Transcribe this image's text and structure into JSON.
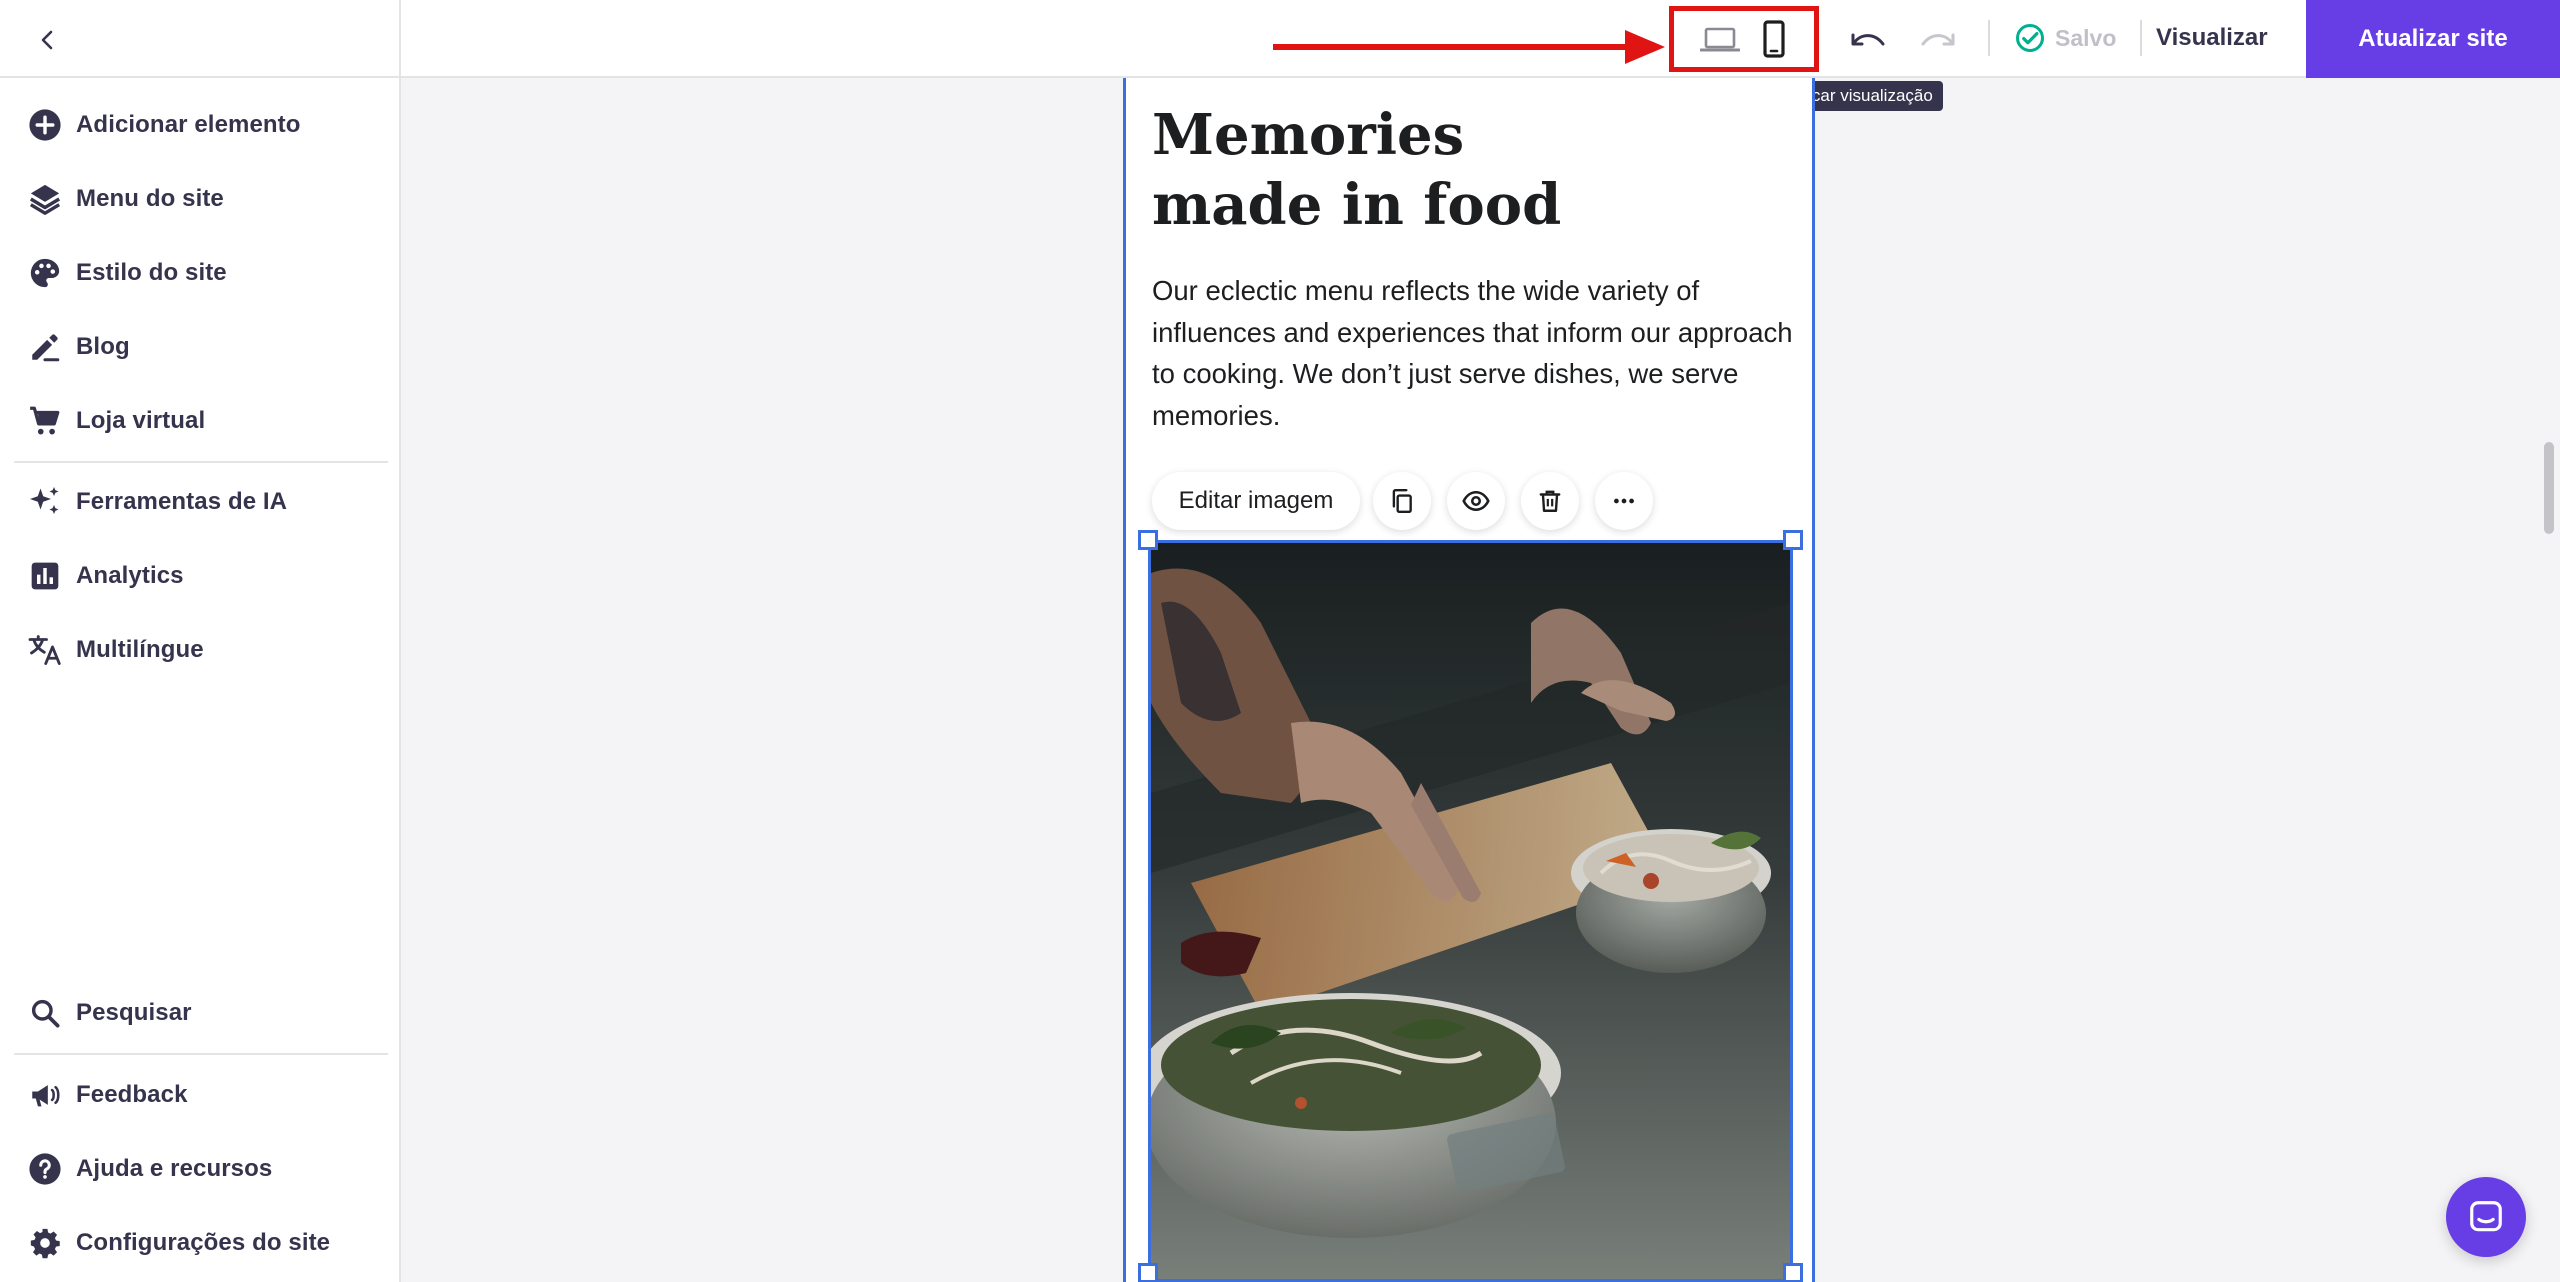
{
  "sidebar": {
    "back_icon": "chevron-left-icon",
    "items": [
      {
        "label": "Adicionar elemento",
        "icon": "add-circle-icon"
      },
      {
        "label": "Menu do site",
        "icon": "layers-icon"
      },
      {
        "label": "Estilo do site",
        "icon": "palette-icon"
      },
      {
        "label": "Blog",
        "icon": "pen-icon"
      },
      {
        "label": "Loja virtual",
        "icon": "cart-icon"
      },
      {
        "label": "Ferramentas de IA",
        "icon": "sparkles-icon"
      },
      {
        "label": "Analytics",
        "icon": "chart-icon"
      },
      {
        "label": "Multilíngue",
        "icon": "translate-icon"
      }
    ],
    "bottom_items": [
      {
        "label": "Pesquisar",
        "icon": "search-icon"
      },
      {
        "label": "Feedback",
        "icon": "megaphone-icon"
      },
      {
        "label": "Ajuda e recursos",
        "icon": "help-icon"
      },
      {
        "label": "Configurações do site",
        "icon": "gear-icon"
      }
    ]
  },
  "topbar": {
    "device_desktop_icon": "laptop-icon",
    "device_mobile_icon": "phone-icon",
    "undo_icon": "undo-icon",
    "redo_icon": "redo-icon",
    "saved_label": "Salvo",
    "preview_label": "Visualizar",
    "publish_label": "Atualizar site",
    "tooltip": "Trocar visualização"
  },
  "canvas": {
    "headline": "Memories made in food",
    "body": "Our eclectic menu reflects the wide variety of influences and experiences that inform our approach to cooking. We don’t just serve dishes, we serve memories.",
    "image_toolbar": {
      "edit_label": "Editar imagem",
      "duplicate_icon": "copy-icon",
      "visibility_icon": "eye-icon",
      "delete_icon": "trash-icon",
      "more_icon": "more-icon"
    },
    "image_alt": "Chef hands arranging noodle bowls"
  },
  "chat": {
    "icon": "chat-icon"
  },
  "colors": {
    "accent": "#673de6",
    "selection": "#3b6fe0",
    "annotation": "#e11414",
    "saved_check": "#00b090"
  }
}
